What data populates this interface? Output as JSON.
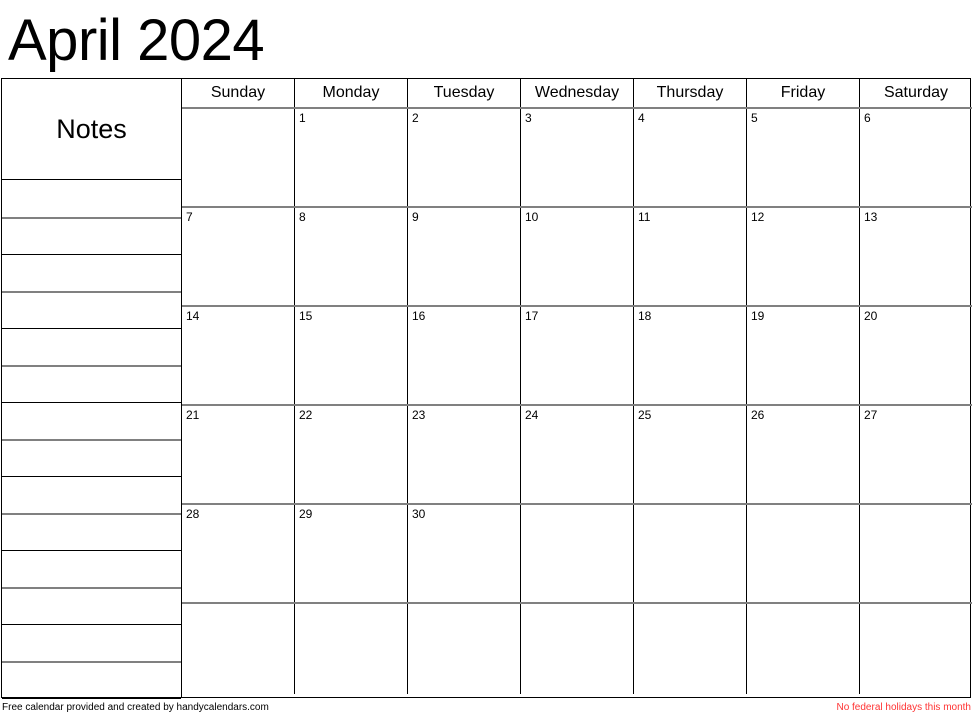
{
  "title": "April 2024",
  "notes": {
    "heading": "Notes",
    "line_count": 14
  },
  "calendar": {
    "day_headers": [
      "Sunday",
      "Monday",
      "Tuesday",
      "Wednesday",
      "Thursday",
      "Friday",
      "Saturday"
    ],
    "weeks": [
      [
        "",
        "1",
        "2",
        "3",
        "4",
        "5",
        "6"
      ],
      [
        "7",
        "8",
        "9",
        "10",
        "11",
        "12",
        "13"
      ],
      [
        "14",
        "15",
        "16",
        "17",
        "18",
        "19",
        "20"
      ],
      [
        "21",
        "22",
        "23",
        "24",
        "25",
        "26",
        "27"
      ],
      [
        "28",
        "29",
        "30",
        "",
        "",
        "",
        ""
      ],
      [
        "",
        "",
        "",
        "",
        "",
        "",
        ""
      ]
    ]
  },
  "footer": {
    "left": "Free calendar provided and created by handycalendars.com",
    "right": "No federal holidays this month",
    "right_color": "#ff3333"
  }
}
